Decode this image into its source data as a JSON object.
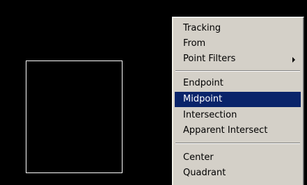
{
  "context_menu": {
    "items": [
      {
        "label": "Tracking"
      },
      {
        "label": "From"
      },
      {
        "label": "Point Filters",
        "has_submenu": true
      },
      {
        "label": "Endpoint"
      },
      {
        "label": "Midpoint",
        "highlighted": true
      },
      {
        "label": "Intersection"
      },
      {
        "label": "Apparent Intersect"
      },
      {
        "label": "Center"
      },
      {
        "label": "Quadrant"
      }
    ]
  },
  "colors": {
    "canvas_background": "#000000",
    "drawn_line": "#ffffff",
    "menu_background": "#d4d0c8",
    "highlight_background": "#0a246a",
    "highlight_text": "#ffffff"
  },
  "icons": {
    "submenu_indicator": "submenu-arrow-icon"
  }
}
